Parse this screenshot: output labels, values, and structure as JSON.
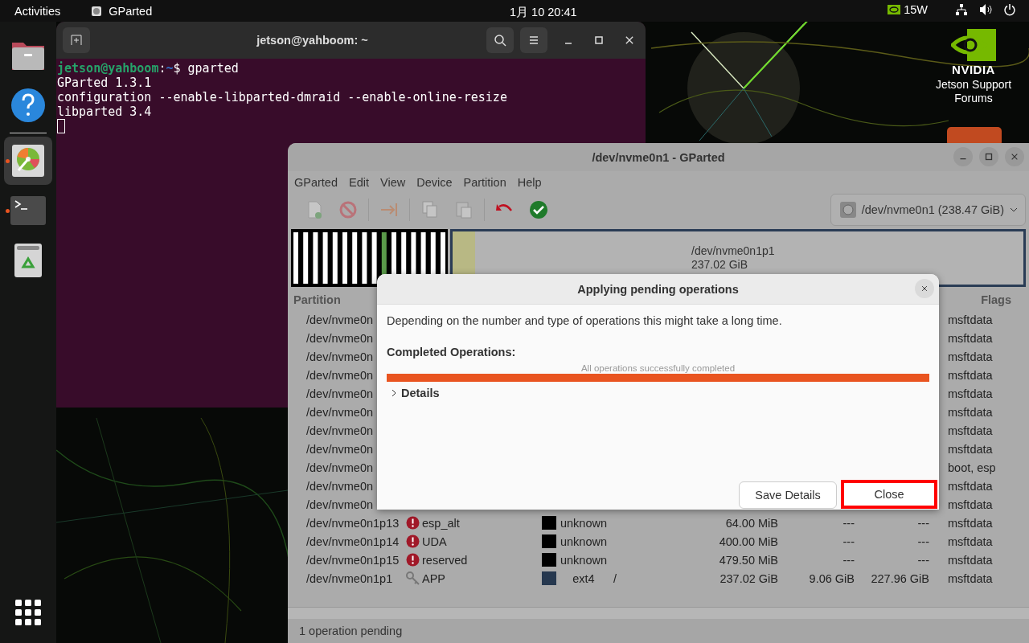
{
  "top_bar": {
    "activities": "Activities",
    "app_name": "GParted",
    "clock": "1月 10  20:41",
    "power_mode": "15W"
  },
  "dock": {
    "items": [
      {
        "kind": "files",
        "running": false,
        "selected": false
      },
      {
        "kind": "help",
        "running": false,
        "selected": false
      },
      {
        "kind": "gparted",
        "running": true,
        "selected": true
      },
      {
        "kind": "terminal",
        "running": true,
        "selected": false
      },
      {
        "kind": "trash",
        "running": false,
        "selected": false
      }
    ]
  },
  "desktop": {
    "brand": "NVIDIA",
    "label": "Jetson Support Forums"
  },
  "terminal": {
    "title": "jetson@yahboom: ~",
    "lines": [
      {
        "segments": [
          {
            "kind": "user",
            "text": "jetson@yahboom"
          },
          {
            "kind": "plain",
            "text": ":"
          },
          {
            "kind": "path",
            "text": "~"
          },
          {
            "kind": "plain",
            "text": "$ gparted"
          }
        ]
      },
      {
        "segments": [
          {
            "kind": "plain",
            "text": "GParted 1.3.1"
          }
        ]
      },
      {
        "segments": [
          {
            "kind": "plain",
            "text": "configuration --enable-libparted-dmraid --enable-online-resize"
          }
        ]
      },
      {
        "segments": [
          {
            "kind": "plain",
            "text": "libparted 3.4"
          }
        ]
      }
    ]
  },
  "gparted": {
    "title": "/dev/nvme0n1 - GParted",
    "menu": [
      "GParted",
      "Edit",
      "View",
      "Device",
      "Partition",
      "Help"
    ],
    "toolbar": [
      {
        "kind": "new",
        "disabled": true
      },
      {
        "kind": "delete",
        "disabled": true
      },
      {
        "kind": "resize",
        "disabled": true
      },
      {
        "kind": "copy",
        "disabled": true
      },
      {
        "kind": "paste",
        "disabled": true
      },
      {
        "kind": "undo",
        "disabled": false
      },
      {
        "kind": "apply",
        "disabled": false
      }
    ],
    "device": "/dev/nvme0n1 (238.47 GiB)",
    "disk_map": {
      "partition": "/dev/nvme0n1p1",
      "size": "237.02 GiB",
      "level": 0.04
    },
    "columns": [
      "Partition",
      "Flags"
    ],
    "rows": [
      {
        "kind": "covered",
        "partition": "/dev/nvme0n",
        "flags": "msftdata"
      },
      {
        "kind": "covered",
        "partition": "/dev/nvme0n",
        "flags": "msftdata"
      },
      {
        "kind": "covered",
        "partition": "/dev/nvme0n",
        "flags": "msftdata"
      },
      {
        "kind": "covered",
        "partition": "/dev/nvme0n",
        "flags": "msftdata"
      },
      {
        "kind": "covered",
        "partition": "/dev/nvme0n",
        "flags": "msftdata"
      },
      {
        "kind": "covered",
        "partition": "/dev/nvme0n",
        "flags": "msftdata"
      },
      {
        "kind": "covered",
        "partition": "/dev/nvme0n",
        "flags": "msftdata"
      },
      {
        "kind": "covered",
        "partition": "/dev/nvme0n",
        "flags": "msftdata"
      },
      {
        "kind": "covered",
        "partition": "/dev/nvme0n",
        "flags": "boot, esp"
      },
      {
        "kind": "covered",
        "partition": "/dev/nvme0n",
        "flags": "msftdata"
      },
      {
        "kind": "covered",
        "partition": "/dev/nvme0n",
        "flags": "msftdata"
      },
      {
        "kind": "warning",
        "partition": "/dev/nvme0n1p13",
        "name": "esp_alt",
        "color": "#000000",
        "filesystem": "unknown",
        "size": "64.00 MiB",
        "used": "---",
        "unused": "---",
        "flags": "msftdata"
      },
      {
        "kind": "warning",
        "partition": "/dev/nvme0n1p14",
        "name": "UDA",
        "color": "#000000",
        "filesystem": "unknown",
        "size": "400.00 MiB",
        "used": "---",
        "unused": "---",
        "flags": "msftdata"
      },
      {
        "kind": "warning",
        "partition": "/dev/nvme0n1p15",
        "name": "reserved",
        "color": "#000000",
        "filesystem": "unknown",
        "size": "479.50 MiB",
        "used": "---",
        "unused": "---",
        "flags": "msftdata"
      },
      {
        "kind": "mounted",
        "partition": "/dev/nvme0n1p1",
        "name": "APP",
        "color": "#26384f",
        "filesystem": "ext4",
        "mount": "/",
        "size": "237.02 GiB",
        "used": "9.06 GiB",
        "unused": "227.96 GiB",
        "flags": "msftdata"
      }
    ],
    "status": "1 operation pending"
  },
  "dialog": {
    "title": "Applying pending operations",
    "message": "Depending on the number and type of operations this might take a long time.",
    "section": "Completed Operations:",
    "progress_text": "All operations successfully completed",
    "level": 1,
    "details": {
      "label": "Details",
      "expanded": false
    },
    "buttons": [
      {
        "label": "Save Details",
        "highlighted": false
      },
      {
        "label": "Close",
        "highlighted": true
      }
    ]
  }
}
